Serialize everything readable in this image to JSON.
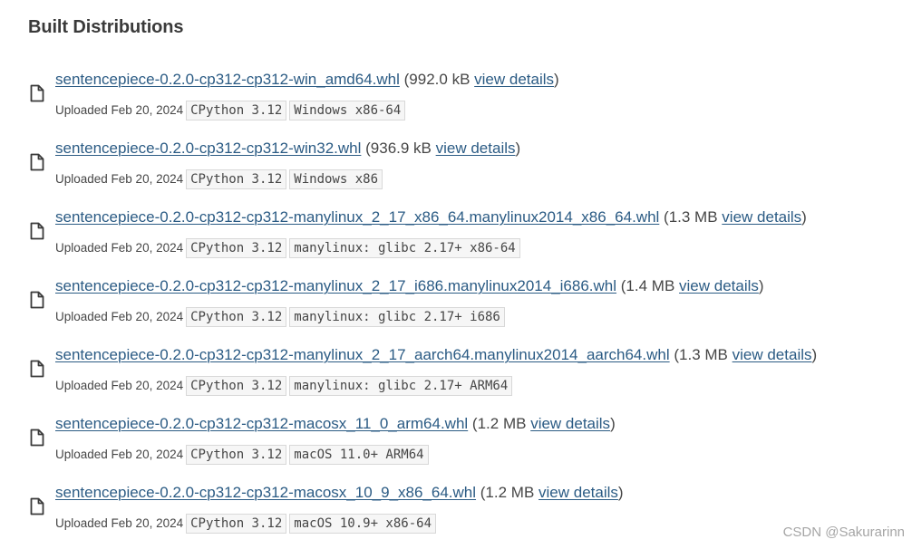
{
  "section": {
    "title": "Built Distributions"
  },
  "meta_prefix": "Uploaded",
  "files": [
    {
      "filename": "sentencepiece-0.2.0-cp312-cp312-win_amd64.whl",
      "size_open": "(992.0 kB",
      "details_label": "view details",
      "size_close": ")",
      "uploaded": "Uploaded Feb 20, 2024",
      "python_tag": "CPython 3.12",
      "platform_tag": "Windows x86-64"
    },
    {
      "filename": "sentencepiece-0.2.0-cp312-cp312-win32.whl",
      "size_open": "(936.9 kB",
      "details_label": "view details",
      "size_close": ")",
      "uploaded": "Uploaded Feb 20, 2024",
      "python_tag": "CPython 3.12",
      "platform_tag": "Windows x86"
    },
    {
      "filename": "sentencepiece-0.2.0-cp312-cp312-manylinux_2_17_x86_64.manylinux2014_x86_64.whl",
      "size_open": "(1.3 MB",
      "details_label": "view details",
      "size_close": ")",
      "uploaded": "Uploaded Feb 20, 2024",
      "python_tag": "CPython 3.12",
      "platform_tag": "manylinux: glibc 2.17+ x86-64"
    },
    {
      "filename": "sentencepiece-0.2.0-cp312-cp312-manylinux_2_17_i686.manylinux2014_i686.whl",
      "size_open": "(1.4 MB",
      "details_label": "view details",
      "size_close": ")",
      "uploaded": "Uploaded Feb 20, 2024",
      "python_tag": "CPython 3.12",
      "platform_tag": "manylinux: glibc 2.17+ i686"
    },
    {
      "filename": "sentencepiece-0.2.0-cp312-cp312-manylinux_2_17_aarch64.manylinux2014_aarch64.whl",
      "size_open": "(1.3 MB",
      "details_label": "view details",
      "size_close": ")",
      "uploaded": "Uploaded Feb 20, 2024",
      "python_tag": "CPython 3.12",
      "platform_tag": "manylinux: glibc 2.17+ ARM64"
    },
    {
      "filename": "sentencepiece-0.2.0-cp312-cp312-macosx_11_0_arm64.whl",
      "size_open": "(1.2 MB",
      "details_label": "view details",
      "size_close": ")",
      "uploaded": "Uploaded Feb 20, 2024",
      "python_tag": "CPython 3.12",
      "platform_tag": "macOS 11.0+ ARM64"
    },
    {
      "filename": "sentencepiece-0.2.0-cp312-cp312-macosx_10_9_x86_64.whl",
      "size_open": "(1.2 MB",
      "details_label": "view details",
      "size_close": ")",
      "uploaded": "Uploaded Feb 20, 2024",
      "python_tag": "CPython 3.12",
      "platform_tag": "macOS 10.9+ x86-64"
    }
  ],
  "watermark": "CSDN @Sakurarinn",
  "icons": {
    "file": "file-icon"
  },
  "colors": {
    "link": "#2b5b84",
    "text": "#464646",
    "tag_border": "#d8d8d8",
    "tag_background": "#f6f6f6"
  }
}
